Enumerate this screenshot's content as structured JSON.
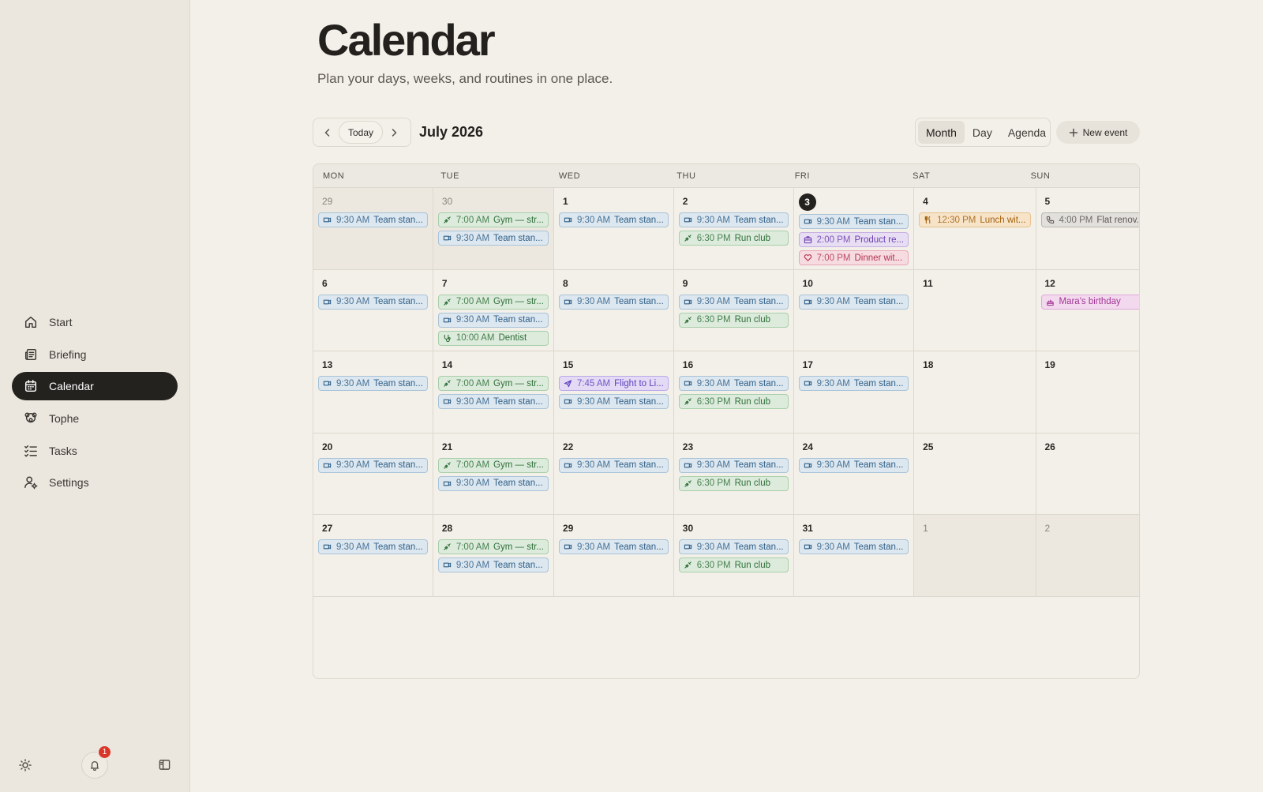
{
  "sidebar": {
    "items": [
      {
        "label": "Start",
        "icon": "home-icon"
      },
      {
        "label": "Briefing",
        "icon": "newspaper-icon"
      },
      {
        "label": "Calendar",
        "icon": "calendar-icon",
        "active": true
      },
      {
        "label": "Tophe",
        "icon": "bear-icon"
      },
      {
        "label": "Tasks",
        "icon": "checklist-icon"
      },
      {
        "label": "Settings",
        "icon": "user-settings-icon"
      }
    ],
    "notification_count": "1"
  },
  "header": {
    "title": "Calendar",
    "subtitle": "Plan your days, weeks, and routines in one place."
  },
  "toolbar": {
    "today_label": "Today",
    "month_label": "July 2026",
    "views": [
      "Month",
      "Day",
      "Agenda"
    ],
    "selected_view": "Month",
    "new_event_label": "New event"
  },
  "calendar": {
    "weekdays": [
      "MON",
      "TUE",
      "WED",
      "THU",
      "FRI",
      "SAT",
      "SUN"
    ],
    "days": [
      {
        "n": "29",
        "out": true,
        "events": [
          {
            "time": "9:30 AM",
            "title": "Team stan...",
            "color": "blue",
            "icon": "video"
          }
        ]
      },
      {
        "n": "30",
        "out": true,
        "events": [
          {
            "time": "7:00 AM",
            "title": "Gym — str...",
            "color": "green",
            "icon": "dumbbell"
          },
          {
            "time": "9:30 AM",
            "title": "Team stan...",
            "color": "blue",
            "icon": "video"
          }
        ]
      },
      {
        "n": "1",
        "events": [
          {
            "time": "9:30 AM",
            "title": "Team stan...",
            "color": "blue",
            "icon": "video"
          }
        ]
      },
      {
        "n": "2",
        "events": [
          {
            "time": "9:30 AM",
            "title": "Team stan...",
            "color": "blue",
            "icon": "video"
          },
          {
            "time": "6:30 PM",
            "title": "Run club",
            "color": "green",
            "icon": "dumbbell"
          }
        ]
      },
      {
        "n": "3",
        "today": true,
        "events": [
          {
            "time": "9:30 AM",
            "title": "Team stan...",
            "color": "blue",
            "icon": "video"
          },
          {
            "time": "2:00 PM",
            "title": "Product re...",
            "color": "purple",
            "icon": "briefcase"
          },
          {
            "time": "7:00 PM",
            "title": "Dinner wit...",
            "color": "pink",
            "icon": "heart"
          }
        ]
      },
      {
        "n": "4",
        "events": [
          {
            "time": "12:30 PM",
            "title": "Lunch wit...",
            "color": "orange",
            "icon": "fork"
          }
        ]
      },
      {
        "n": "5",
        "events": [
          {
            "time": "4:00 PM",
            "title": "Flat renov...",
            "color": "gray",
            "icon": "phone"
          }
        ]
      },
      {
        "n": "6",
        "events": [
          {
            "time": "9:30 AM",
            "title": "Team stan...",
            "color": "blue",
            "icon": "video"
          }
        ]
      },
      {
        "n": "7",
        "events": [
          {
            "time": "7:00 AM",
            "title": "Gym — str...",
            "color": "green",
            "icon": "dumbbell"
          },
          {
            "time": "9:30 AM",
            "title": "Team stan...",
            "color": "blue",
            "icon": "video"
          },
          {
            "time": "10:00 AM",
            "title": "Dentist",
            "color": "green",
            "icon": "stethoscope"
          }
        ]
      },
      {
        "n": "8",
        "events": [
          {
            "time": "9:30 AM",
            "title": "Team stan...",
            "color": "blue",
            "icon": "video"
          }
        ]
      },
      {
        "n": "9",
        "events": [
          {
            "time": "9:30 AM",
            "title": "Team stan...",
            "color": "blue",
            "icon": "video"
          },
          {
            "time": "6:30 PM",
            "title": "Run club",
            "color": "green",
            "icon": "dumbbell"
          }
        ]
      },
      {
        "n": "10",
        "events": [
          {
            "time": "9:30 AM",
            "title": "Team stan...",
            "color": "blue",
            "icon": "video"
          }
        ]
      },
      {
        "n": "11",
        "events": []
      },
      {
        "n": "12",
        "events": [
          {
            "time": "",
            "title": "Mara's birthday",
            "color": "magenta",
            "icon": "cake"
          }
        ]
      },
      {
        "n": "13",
        "events": [
          {
            "time": "9:30 AM",
            "title": "Team stan...",
            "color": "blue",
            "icon": "video"
          }
        ]
      },
      {
        "n": "14",
        "events": [
          {
            "time": "7:00 AM",
            "title": "Gym — str...",
            "color": "green",
            "icon": "dumbbell"
          },
          {
            "time": "9:30 AM",
            "title": "Team stan...",
            "color": "blue",
            "icon": "video"
          }
        ]
      },
      {
        "n": "15",
        "events": [
          {
            "time": "7:45 AM",
            "title": "Flight to Li...",
            "color": "violet",
            "icon": "plane"
          },
          {
            "time": "9:30 AM",
            "title": "Team stan...",
            "color": "blue",
            "icon": "video"
          }
        ]
      },
      {
        "n": "16",
        "events": [
          {
            "time": "9:30 AM",
            "title": "Team stan...",
            "color": "blue",
            "icon": "video"
          },
          {
            "time": "6:30 PM",
            "title": "Run club",
            "color": "green",
            "icon": "dumbbell"
          }
        ]
      },
      {
        "n": "17",
        "events": [
          {
            "time": "9:30 AM",
            "title": "Team stan...",
            "color": "blue",
            "icon": "video"
          }
        ]
      },
      {
        "n": "18",
        "events": []
      },
      {
        "n": "19",
        "events": []
      },
      {
        "n": "20",
        "events": [
          {
            "time": "9:30 AM",
            "title": "Team stan...",
            "color": "blue",
            "icon": "video"
          }
        ]
      },
      {
        "n": "21",
        "events": [
          {
            "time": "7:00 AM",
            "title": "Gym — str...",
            "color": "green",
            "icon": "dumbbell"
          },
          {
            "time": "9:30 AM",
            "title": "Team stan...",
            "color": "blue",
            "icon": "video"
          }
        ]
      },
      {
        "n": "22",
        "events": [
          {
            "time": "9:30 AM",
            "title": "Team stan...",
            "color": "blue",
            "icon": "video"
          }
        ]
      },
      {
        "n": "23",
        "events": [
          {
            "time": "9:30 AM",
            "title": "Team stan...",
            "color": "blue",
            "icon": "video"
          },
          {
            "time": "6:30 PM",
            "title": "Run club",
            "color": "green",
            "icon": "dumbbell"
          }
        ]
      },
      {
        "n": "24",
        "events": [
          {
            "time": "9:30 AM",
            "title": "Team stan...",
            "color": "blue",
            "icon": "video"
          }
        ]
      },
      {
        "n": "25",
        "events": []
      },
      {
        "n": "26",
        "events": []
      },
      {
        "n": "27",
        "events": [
          {
            "time": "9:30 AM",
            "title": "Team stan...",
            "color": "blue",
            "icon": "video"
          }
        ]
      },
      {
        "n": "28",
        "events": [
          {
            "time": "7:00 AM",
            "title": "Gym — str...",
            "color": "green",
            "icon": "dumbbell"
          },
          {
            "time": "9:30 AM",
            "title": "Team stan...",
            "color": "blue",
            "icon": "video"
          }
        ]
      },
      {
        "n": "29",
        "events": [
          {
            "time": "9:30 AM",
            "title": "Team stan...",
            "color": "blue",
            "icon": "video"
          }
        ]
      },
      {
        "n": "30",
        "events": [
          {
            "time": "9:30 AM",
            "title": "Team stan...",
            "color": "blue",
            "icon": "video"
          },
          {
            "time": "6:30 PM",
            "title": "Run club",
            "color": "green",
            "icon": "dumbbell"
          }
        ]
      },
      {
        "n": "31",
        "events": [
          {
            "time": "9:30 AM",
            "title": "Team stan...",
            "color": "blue",
            "icon": "video"
          }
        ]
      },
      {
        "n": "1",
        "out": true,
        "events": []
      },
      {
        "n": "2",
        "out": true,
        "events": []
      }
    ]
  }
}
